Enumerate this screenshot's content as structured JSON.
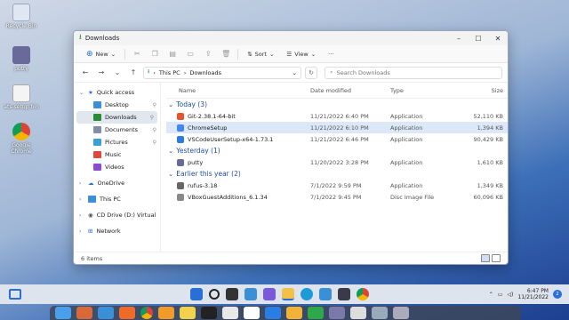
{
  "desktop": {
    "icons": [
      {
        "label": "Recycle Bin"
      },
      {
        "label": "putty"
      },
      {
        "label": "ats-setup.bin"
      },
      {
        "label": "Google Chrome"
      }
    ]
  },
  "window": {
    "title": "Downloads",
    "toolbar": {
      "new": "New",
      "sort": "Sort",
      "view": "View",
      "more": "···"
    },
    "address": {
      "segments": [
        "This PC",
        "Downloads"
      ]
    },
    "search": {
      "placeholder": "Search Downloads"
    },
    "sidebar": {
      "home": "Quick access",
      "quick": [
        "Desktop",
        "Downloads",
        "Documents",
        "Pictures",
        "Music",
        "Videos"
      ],
      "locations": [
        "OneDrive",
        "This PC",
        "CD Drive (D:) Virtual",
        "Network"
      ]
    },
    "columns": {
      "name": "Name",
      "date": "Date modified",
      "type": "Type",
      "size": "Size"
    },
    "groups": [
      {
        "label": "Today (3)",
        "files": [
          {
            "name": "Git-2.38.1-64-bit",
            "date": "11/21/2022 6:40 PM",
            "type": "Application",
            "size": "52,110 KB",
            "color": "#e8542a"
          },
          {
            "name": "ChromeSetup",
            "date": "11/21/2022 6:10 PM",
            "type": "Application",
            "size": "1,394 KB",
            "color": "#4285f4"
          },
          {
            "name": "VSCodeUserSetup-x64-1.73.1",
            "date": "11/21/2022 6:46 PM",
            "type": "Application",
            "size": "90,429 KB",
            "color": "#2a7de1"
          }
        ]
      },
      {
        "label": "Yesterday (1)",
        "files": [
          {
            "name": "putty",
            "date": "11/20/2022 3:28 PM",
            "type": "Application",
            "size": "1,610 KB",
            "color": "#6a6a9a"
          }
        ]
      },
      {
        "label": "Earlier this year (2)",
        "files": [
          {
            "name": "rufus-3.18",
            "date": "7/1/2022 9:59 PM",
            "type": "Application",
            "size": "1,349 KB",
            "color": "#666"
          },
          {
            "name": "VBoxGuestAdditions_6.1.34",
            "date": "7/1/2022 9:45 PM",
            "type": "Disc Image File",
            "size": "60,096 KB",
            "color": "#888"
          }
        ]
      }
    ],
    "status": "6 items"
  },
  "taskbar": {
    "time": "6:47 PM",
    "date": "11/21/2022",
    "notif": "2"
  }
}
